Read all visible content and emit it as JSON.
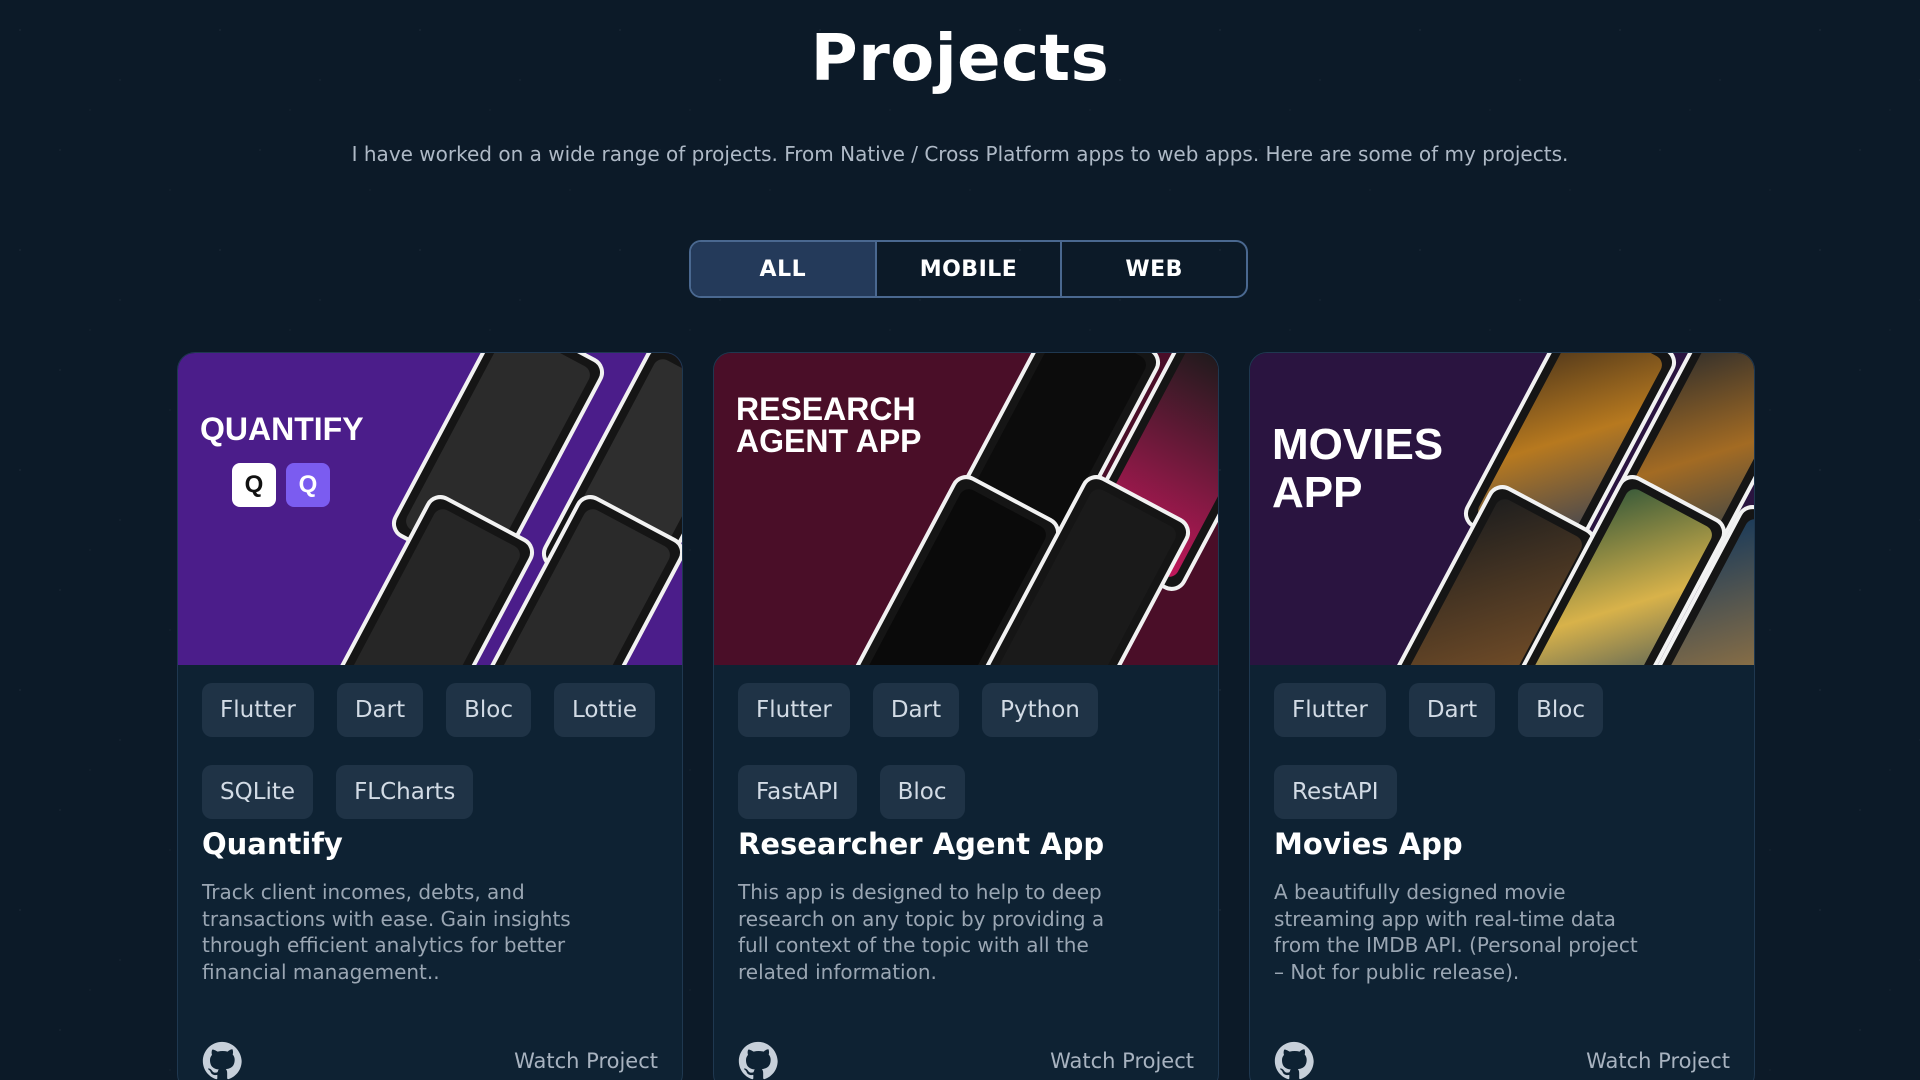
{
  "header": {
    "title": "Projects",
    "subtitle": "I have worked on a wide range of projects. From Native / Cross Platform apps to web apps. Here are some of my projects."
  },
  "filters": [
    {
      "label": "ALL",
      "active": true
    },
    {
      "label": "MOBILE",
      "active": false
    },
    {
      "label": "WEB",
      "active": false
    }
  ],
  "projects": [
    {
      "banner_title": "QUANTIFY",
      "banner_color": "#4b1d8a",
      "tags": [
        "Flutter",
        "Dart",
        "Bloc",
        "Lottie",
        "SQLite",
        "FLCharts"
      ],
      "title": "Quantify",
      "description": "Track client incomes, debts, and transactions with ease. Gain insights through efficient analytics for better financial management..",
      "github_icon": "github-icon",
      "watch_label": "Watch Project"
    },
    {
      "banner_title_line1": "RESEARCH",
      "banner_title_line2": "AGENT APP",
      "banner_color": "#4a0e28",
      "tags": [
        "Flutter",
        "Dart",
        "Python",
        "FastAPI",
        "Bloc"
      ],
      "title": "Researcher Agent App",
      "description": "This app is designed to help to deep research on any topic by providing a full context of the topic with all the related information.",
      "github_icon": "github-icon",
      "watch_label": "Watch Project"
    },
    {
      "banner_title_line1": "MOVIES",
      "banner_title_line2": "APP",
      "banner_color": "#2a1440",
      "tags": [
        "Flutter",
        "Dart",
        "Bloc",
        "RestAPI"
      ],
      "title": "Movies App",
      "description": "A beautifully designed movie streaming app with real-time data from the IMDB API. (Personal project – Not for public release).",
      "github_icon": "github-icon",
      "watch_label": "Watch Project"
    }
  ]
}
